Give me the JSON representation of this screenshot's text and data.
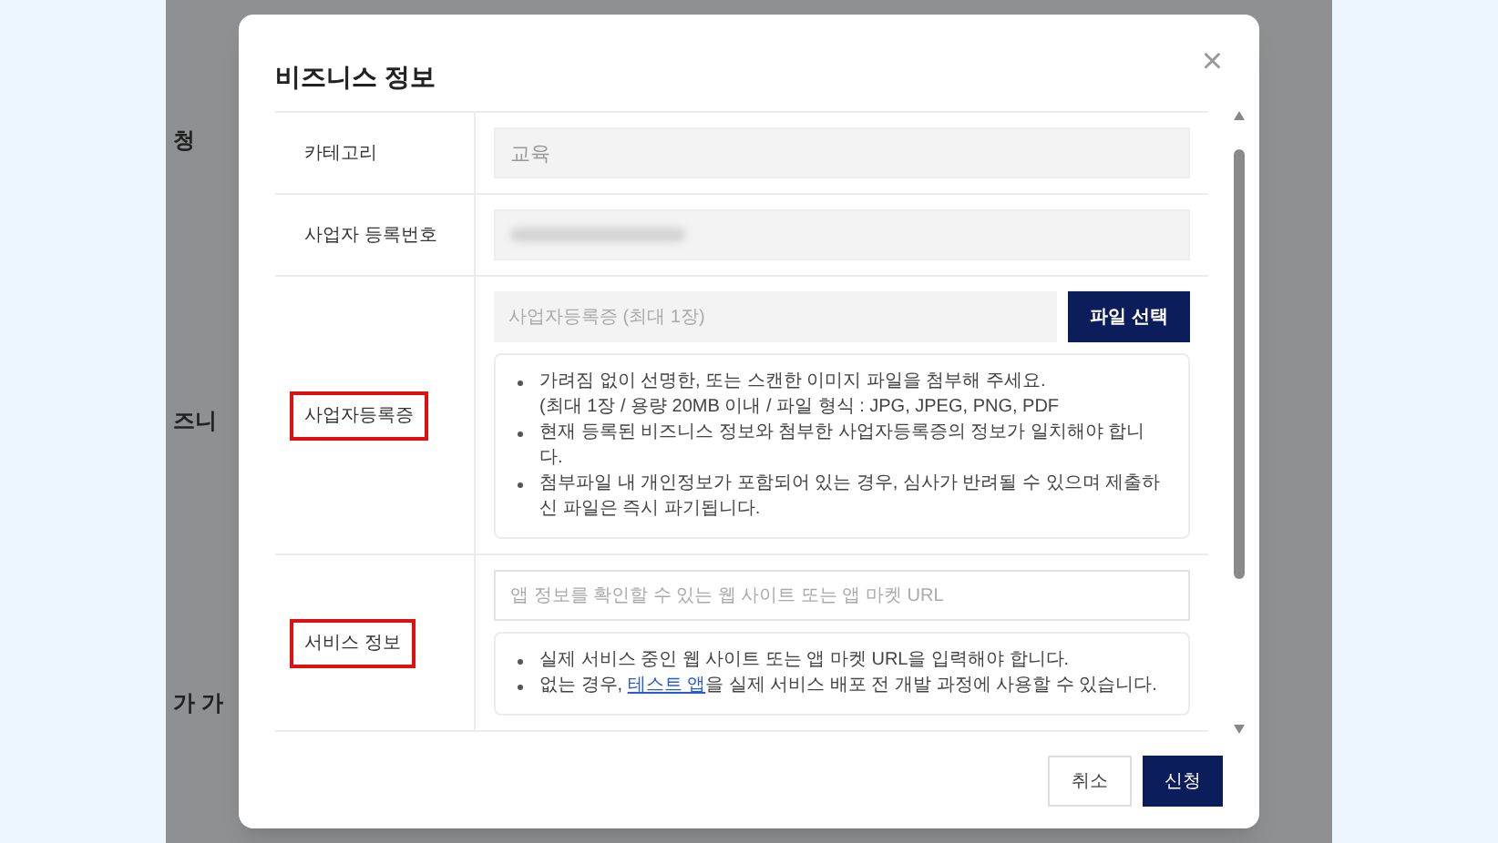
{
  "background_page": {
    "fragments": [
      "청",
      "즈니",
      "가 가"
    ]
  },
  "dialog": {
    "title": "비즈니스 정보",
    "close": "×",
    "rows": [
      {
        "kind": "text",
        "label": "카테고리",
        "highlighted": false,
        "value": "교육",
        "disabled": true
      },
      {
        "kind": "redacted",
        "label": "사업자 등록번호",
        "highlighted": false
      },
      {
        "kind": "file",
        "label": "사업자등록증",
        "highlighted": true,
        "placeholder": "사업자등록증 (최대 1장)",
        "button": "파일 선택",
        "notes": [
          {
            "bullet": true,
            "parts": [
              {
                "kind": "text",
                "text": "가려짐 없이 선명한, 또는 스캔한 이미지 파일을 첨부해 주세요."
              }
            ]
          },
          {
            "bullet": false,
            "parts": [
              {
                "kind": "text",
                "text": "(최대 1장 / 용량 20MB 이내 / 파일 형식 : JPG, JPEG, PNG, PDF"
              }
            ]
          },
          {
            "bullet": true,
            "parts": [
              {
                "kind": "text",
                "text": "현재 등록된 비즈니스 정보와 첨부한 사업자등록증의 정보가 일치해야 합니다."
              }
            ]
          },
          {
            "bullet": true,
            "parts": [
              {
                "kind": "text",
                "text": "첨부파일 내 개인정보가 포함되어 있는 경우, 심사가 반려될 수 있으며 제출하신 파일은 즉시 파기됩니다."
              }
            ]
          }
        ]
      },
      {
        "kind": "url",
        "label": "서비스 정보",
        "highlighted": true,
        "placeholder": "앱 정보를 확인할 수 있는 웹 사이트 또는 앱 마켓 URL",
        "notes": [
          {
            "bullet": true,
            "parts": [
              {
                "kind": "text",
                "text": "실제 서비스 중인 웹 사이트 또는 앱 마켓 URL을 입력해야 합니다."
              }
            ]
          },
          {
            "bullet": true,
            "parts": [
              {
                "kind": "text",
                "text": "없는 경우, "
              },
              {
                "kind": "link",
                "text": "테스트 앱"
              },
              {
                "kind": "text",
                "text": "을 실제 서비스 배포 전 개발 과정에 사용할 수 있습니다."
              }
            ]
          }
        ]
      }
    ],
    "buttons": [
      {
        "label": "취소",
        "primary": false
      },
      {
        "label": "신청",
        "primary": true
      }
    ]
  }
}
